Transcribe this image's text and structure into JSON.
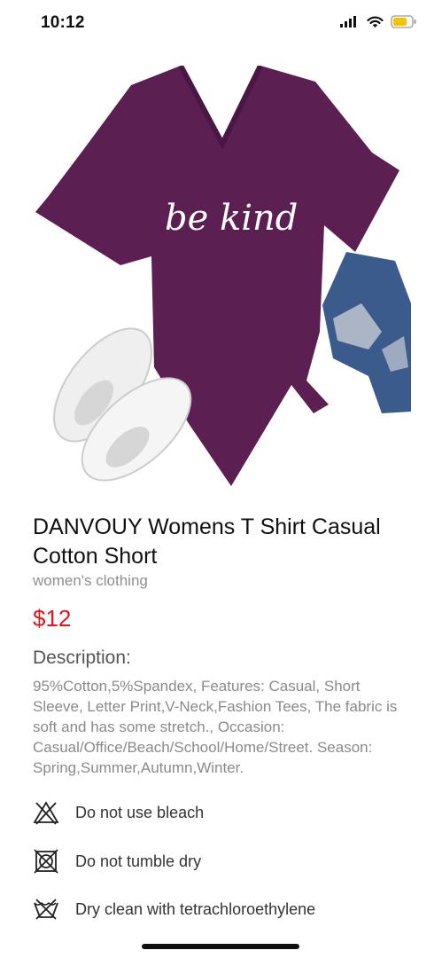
{
  "status_bar": {
    "time": "10:12",
    "icons": [
      "signal-icon",
      "wifi-icon",
      "battery-icon"
    ]
  },
  "product": {
    "image_icon": "tshirt-product-image",
    "image_text": "be kind",
    "title": "DANVOUY Womens T Shirt Casual Cotton Short",
    "category": "women's clothing",
    "price": "$12",
    "description_heading": "Description:",
    "description": "95%Cotton,5%Spandex, Features: Casual, Short Sleeve, Letter Print,V-Neck,Fashion Tees, The fabric is soft and has some stretch., Occasion: Casual/Office/Beach/School/Home/Street. Season: Spring,Summer,Autumn,Winter."
  },
  "care": [
    {
      "label": "Do not use bleach",
      "icon": "no-bleach-icon"
    },
    {
      "label": "Do not tumble dry",
      "icon": "no-tumble-dry-icon"
    },
    {
      "label": "Dry clean with tetrachloroethylene",
      "icon": "dry-clean-icon"
    }
  ],
  "colors": {
    "price": "#e5141b",
    "shirt": "#5b1f52",
    "battery": "#f5c400"
  }
}
